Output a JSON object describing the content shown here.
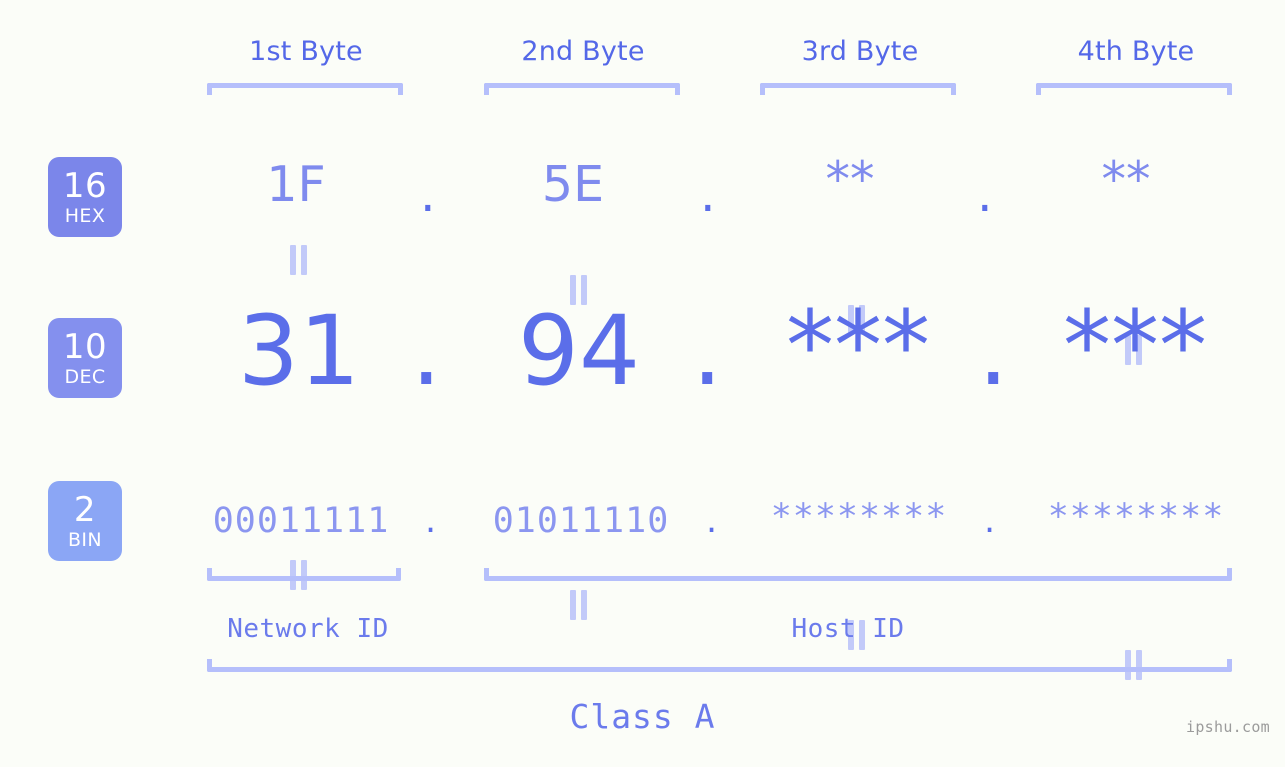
{
  "header": {
    "byte_labels": [
      "1st Byte",
      "2nd Byte",
      "3rd Byte",
      "4th Byte"
    ]
  },
  "bases": [
    {
      "number": "16",
      "name": "HEX",
      "color": "#7b86ea"
    },
    {
      "number": "10",
      "name": "DEC",
      "color": "#8490ee"
    },
    {
      "number": "2",
      "name": "BIN",
      "color": "#8ba6f5"
    }
  ],
  "rows": {
    "hex": {
      "base_number": "16",
      "base_name": "HEX",
      "values": [
        "1F",
        "5E",
        "**",
        "**"
      ],
      "separator": "."
    },
    "dec": {
      "base_number": "10",
      "base_name": "DEC",
      "values": [
        "31",
        "94",
        "***",
        "***"
      ],
      "separator": "."
    },
    "bin": {
      "base_number": "2",
      "base_name": "BIN",
      "values": [
        "00011111",
        "01011110",
        "********",
        "********"
      ],
      "separator": "."
    }
  },
  "connectors": {
    "symbol": "equals-rotated",
    "count_per_row": 4
  },
  "footer": {
    "network_id_label": "Network ID",
    "host_id_label": "Host ID",
    "class_label": "Class A",
    "watermark": "ipshu.com"
  },
  "colors": {
    "background": "#fbfdf8",
    "accent_strong": "#5b6ee9",
    "accent_mid": "#7f8bee",
    "accent_light": "#b5bffb",
    "heading": "#5468e8",
    "watermark": "#9b9b9b"
  }
}
